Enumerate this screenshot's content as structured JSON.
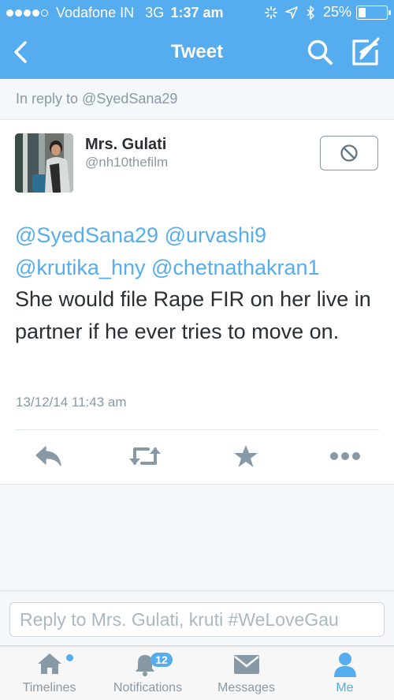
{
  "status_bar": {
    "carrier": "Vodafone IN",
    "network": "3G",
    "time": "1:37 am",
    "battery": "25%",
    "signal_bars": 4,
    "battery_level": 0.25
  },
  "nav": {
    "title": "Tweet",
    "back_icon": "chevron-left-icon",
    "search_icon": "search-icon",
    "compose_icon": "compose-icon"
  },
  "reply_context": "In reply to @SyedSana29",
  "tweet": {
    "author_name": "Mrs. Gulati",
    "author_handle": "@nh10thefilm",
    "mentions": [
      "@SyedSana29",
      "@urvashi9",
      "@krutika_hny",
      "@chetnathakran1"
    ],
    "text": "She would file Rape FIR on her live in partner if he ever tries to move on.",
    "timestamp": "13/12/14 11:43 am",
    "block_icon": "block-icon",
    "actions": [
      "reply-icon",
      "retweet-icon",
      "favorite-icon",
      "more-icon"
    ]
  },
  "compose": {
    "placeholder": "Reply to Mrs. Gulati, kruti #WeLoveGau"
  },
  "tabs": [
    {
      "label": "Timelines",
      "icon": "home-icon"
    },
    {
      "label": "Notifications",
      "icon": "bell-icon",
      "badge": "12"
    },
    {
      "label": "Messages",
      "icon": "envelope-icon"
    },
    {
      "label": "Me",
      "icon": "person-icon",
      "active": true
    }
  ],
  "colors": {
    "accent": "#55acee",
    "text": "#292f33",
    "muted": "#8899a6",
    "background": "#f5f8fa"
  }
}
